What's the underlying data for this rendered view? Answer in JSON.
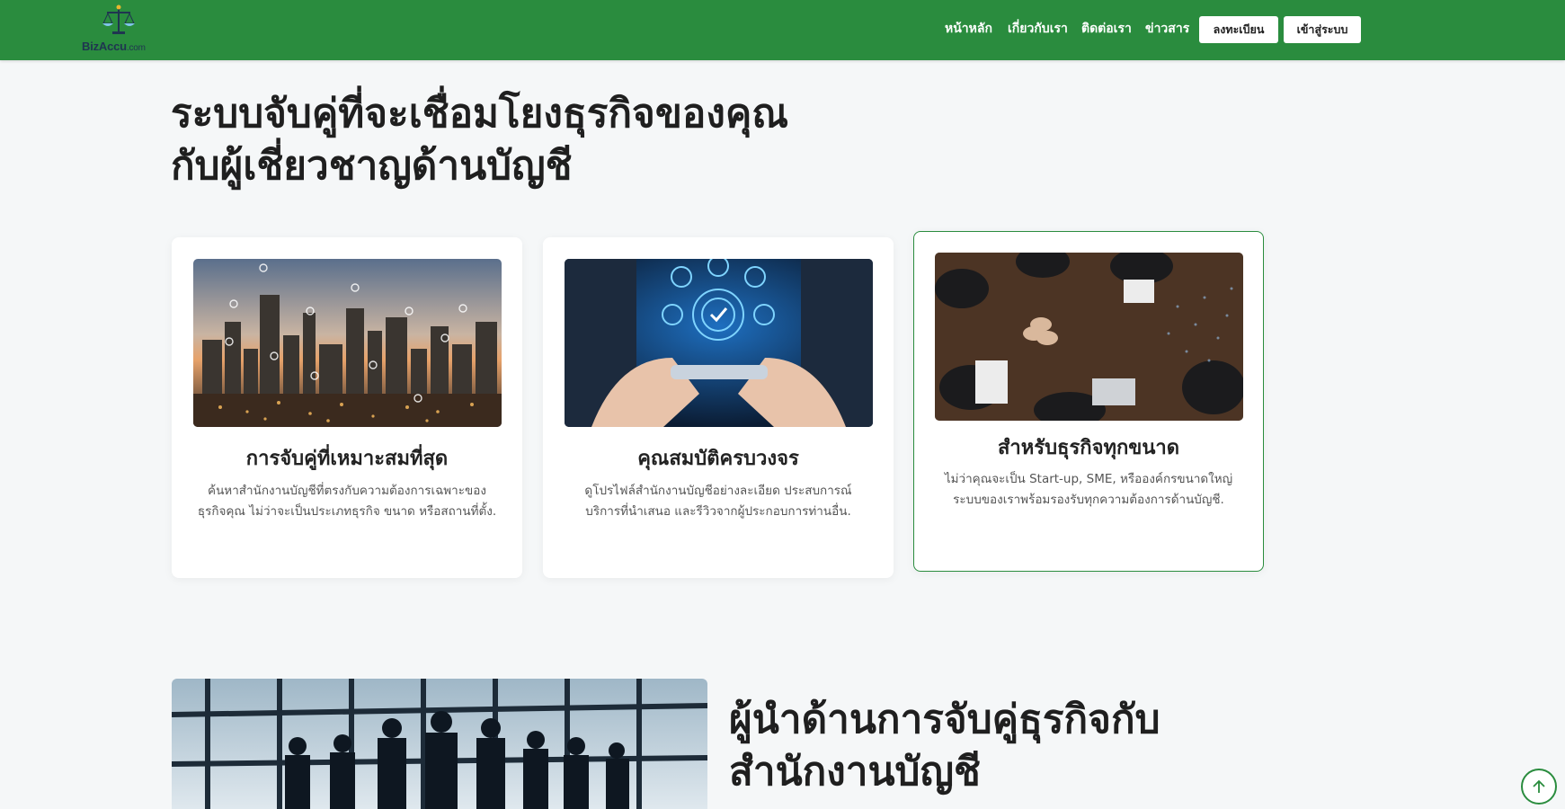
{
  "brand": {
    "name": "BizAccu",
    "suffix": ".com",
    "primary_color": "#2a8c3e"
  },
  "nav": {
    "links": [
      "หน้าหลัก",
      "เกี่ยวกับเรา",
      "ติดต่อเรา",
      "ข่าวสาร"
    ],
    "register_label": "ลงทะเบียน",
    "login_label": "เข้าสู่ระบบ"
  },
  "hero": {
    "title_line1": "ระบบจับคู่ที่จะเชื่อมโยงธุรกิจของคุณ",
    "title_line2": "กับผู้เชี่ยวชาญด้านบัญชี"
  },
  "cards": [
    {
      "title": "การจับคู่ที่เหมาะสมที่สุด",
      "desc_line1": "ค้นหาสำนักงานบัญชีที่ตรงกับความต้องการเฉพาะของ",
      "desc_line2": "ธุรกิจคุณ ไม่ว่าจะเป็นประเภทธุรกิจ ขนาด หรือสถานที่ตั้ง.",
      "image": "city-skyline-with-location-pins"
    },
    {
      "title": "คุณสมบัติครบวงจร",
      "desc_line1": "ดูโปรไฟล์สำนักงานบัญชีอย่างละเอียด ประสบการณ์",
      "desc_line2": "บริการที่นำเสนอ และรีวิวจากผู้ประกอบการท่านอื่น.",
      "image": "hands-holding-phone-with-digital-icons"
    },
    {
      "title": "สำหรับธุรกิจทุกขนาด",
      "desc_line1": "ไม่ว่าคุณจะเป็น Start-up, SME, หรือองค์กรขนาดใหญ่",
      "desc_line2": "ระบบของเราพร้อมรองรับทุกความต้องการด้านบัญชี.",
      "image": "team-hands-together-on-table"
    }
  ],
  "leader": {
    "title_line1": "ผู้นำด้านการจับคู่ธุรกิจกับ",
    "title_line2": "สำนักงานบัญชี",
    "image": "business-team-silhouettes-window"
  },
  "scroll_top_icon": "arrow-up-icon"
}
